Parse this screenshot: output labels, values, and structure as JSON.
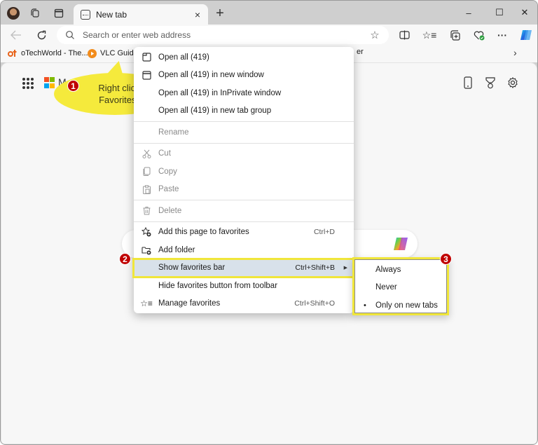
{
  "browser": {
    "tab": {
      "title": "New tab",
      "close_label": "×"
    },
    "new_tab_label": "+",
    "window_controls": {
      "minimize": "–",
      "maximize": "☐",
      "close": "✕"
    },
    "address_bar": {
      "placeholder": "Search or enter web address",
      "value": ""
    },
    "toolbar_icons": [
      "back-icon",
      "refresh-icon",
      "favorite-star-icon",
      "split-screen-icon",
      "favorites-icon",
      "collections-icon",
      "browser-essentials-icon",
      "more-icon",
      "copilot-icon"
    ],
    "more_label": "···"
  },
  "favorites_bar": {
    "items": [
      {
        "label": "oTechWorld - The...",
        "icon": "otechworld-icon"
      },
      {
        "label": "VLC Guide",
        "icon": "vlc-icon"
      }
    ],
    "truncated_item": "er",
    "overflow_label": "›"
  },
  "new_tab_page": {
    "brand_text": "M",
    "ms_colors": [
      "#f25022",
      "#7fba00",
      "#00a4ef",
      "#ffb900"
    ],
    "right_icons": [
      "phone-icon",
      "rewards-icon",
      "settings-icon"
    ]
  },
  "callouts": [
    {
      "number": "1",
      "text_line1": "Right click on",
      "text_line2": "Favorites bar"
    },
    {
      "number": "2"
    },
    {
      "number": "3"
    }
  ],
  "context_menu": {
    "groups": [
      [
        {
          "label": "Open all (419)",
          "icon": "tab-icon",
          "enabled": true
        },
        {
          "label": "Open all (419) in new window",
          "icon": "window-icon",
          "enabled": true
        },
        {
          "label": "Open all (419) in InPrivate window",
          "icon": "inprivate-icon",
          "enabled": true
        },
        {
          "label": "Open all (419) in new tab group",
          "icon": "",
          "enabled": true
        }
      ],
      [
        {
          "label": "Rename",
          "icon": "",
          "enabled": false
        }
      ],
      [
        {
          "label": "Cut",
          "icon": "scissors-icon",
          "enabled": false
        },
        {
          "label": "Copy",
          "icon": "copy-icon",
          "enabled": false
        },
        {
          "label": "Paste",
          "icon": "paste-icon",
          "enabled": false
        }
      ],
      [
        {
          "label": "Delete",
          "icon": "trash-icon",
          "enabled": false
        }
      ],
      [
        {
          "label": "Add this page to favorites",
          "icon": "add-favorite-icon",
          "shortcut": "Ctrl+D",
          "enabled": true
        },
        {
          "label": "Add folder",
          "icon": "add-folder-icon",
          "enabled": true
        },
        {
          "label": "Show favorites bar",
          "icon": "",
          "shortcut": "Ctrl+Shift+B",
          "has_submenu": true,
          "highlighted": true,
          "enabled": true
        },
        {
          "label": "Hide favorites button from toolbar",
          "icon": "",
          "enabled": true
        },
        {
          "label": "Manage favorites",
          "icon": "manage-favorites-icon",
          "shortcut": "Ctrl+Shift+O",
          "enabled": true
        }
      ]
    ]
  },
  "submenu": {
    "items": [
      {
        "label": "Always",
        "selected": false
      },
      {
        "label": "Never",
        "selected": false
      },
      {
        "label": "Only on new tabs",
        "selected": true
      }
    ],
    "selected_marker": "•"
  },
  "colors": {
    "callout_yellow": "#f5ea3c",
    "badge_red": "#c00000",
    "highlight": "#d8e1ea",
    "highlight_border": "#f0e63a"
  }
}
